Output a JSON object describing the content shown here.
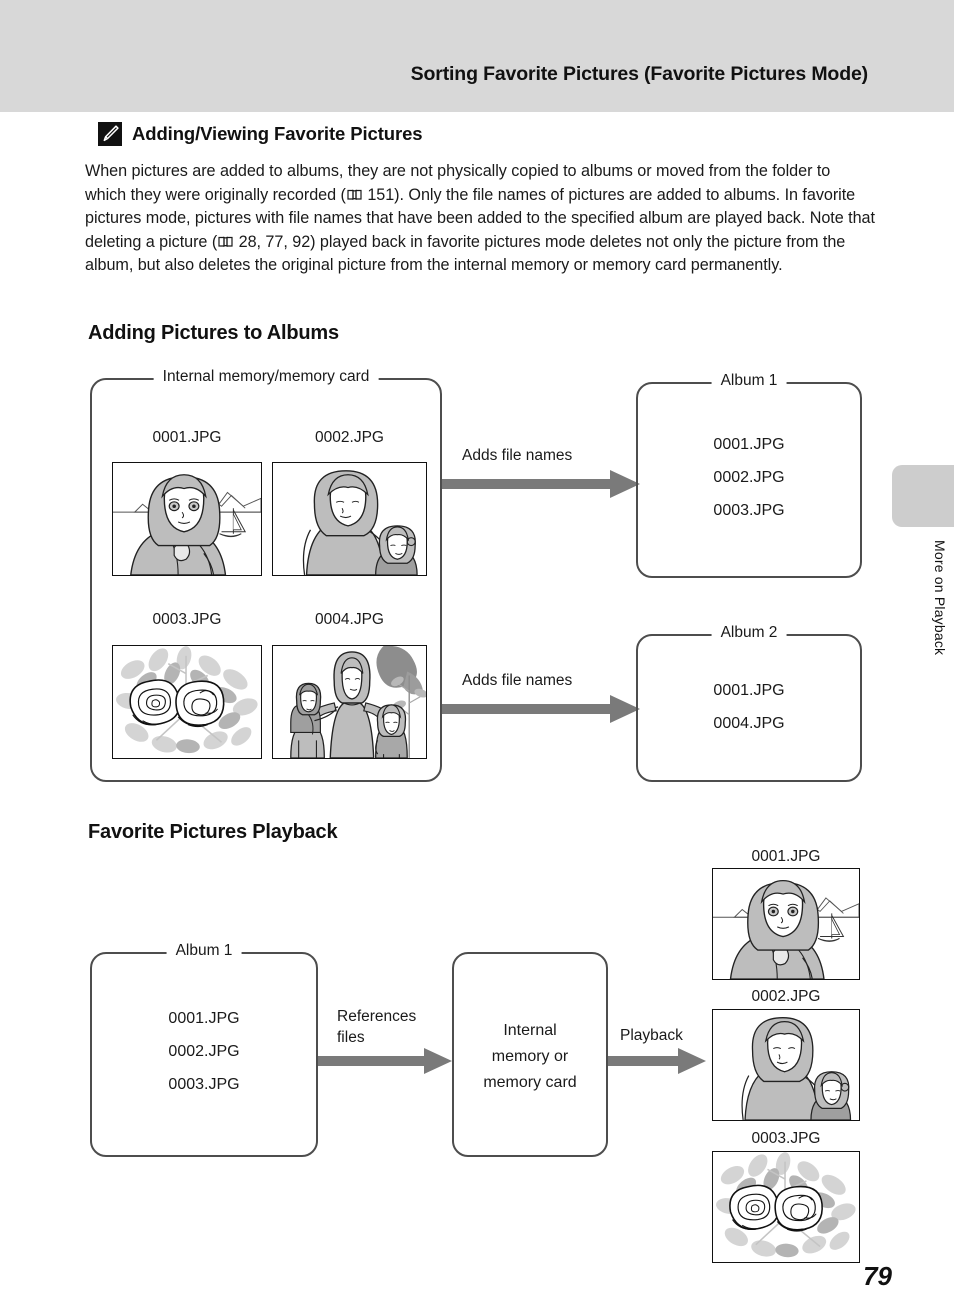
{
  "header": {
    "title": "Sorting Favorite Pictures (Favorite Pictures Mode)"
  },
  "side_tab": {
    "label": "More on Playback"
  },
  "note": {
    "icon": "pencil-icon",
    "title": "Adding/Viewing Favorite Pictures",
    "body_part1": "When pictures are added to albums, they are not physically copied to albums or moved from the folder to which they were originally recorded (",
    "ref1": " 151). Only the file names of pictures are added to albums. In favorite pictures mode, pictures with file names that have been added to the specified album are played back. Note that deleting a picture (",
    "ref2": " 28, 77, 92) played back in favorite pictures mode deletes not only the picture from the album, but also deletes the original picture from the internal memory or memory card permanently."
  },
  "sections": {
    "adding_heading": "Adding Pictures to Albums",
    "playback_heading": "Favorite Pictures Playback"
  },
  "adding_diagram": {
    "source_box_label": "Internal memory/memory card",
    "photos": [
      {
        "caption": "0001.JPG",
        "subject": "woman-at-beach-with-sailboat"
      },
      {
        "caption": "0002.JPG",
        "subject": "woman-holding-childs-hand"
      },
      {
        "caption": "0003.JPG",
        "subject": "roses-flowers"
      },
      {
        "caption": "0004.JPG",
        "subject": "mother-with-two-children"
      }
    ],
    "arrow1_label": "Adds file names",
    "arrow2_label": "Adds file names",
    "album1": {
      "label": "Album 1",
      "files": [
        "0001.JPG",
        "0002.JPG",
        "0003.JPG"
      ]
    },
    "album2": {
      "label": "Album 2",
      "files": [
        "0001.JPG",
        "0004.JPG"
      ]
    }
  },
  "playback_diagram": {
    "album": {
      "label": "Album 1",
      "files": [
        "0001.JPG",
        "0002.JPG",
        "0003.JPG"
      ]
    },
    "arrow1_label": "References\nfiles",
    "memory_box_text": "Internal\nmemory or\nmemory card",
    "arrow2_label": "Playback",
    "photos": [
      {
        "caption": "0001.JPG",
        "subject": "woman-at-beach-with-sailboat"
      },
      {
        "caption": "0002.JPG",
        "subject": "woman-holding-childs-hand"
      },
      {
        "caption": "0003.JPG",
        "subject": "roses-flowers"
      }
    ]
  },
  "footer": {
    "page_number": "79"
  },
  "colors": {
    "header_bg": "#d8d8d8",
    "tab_bg": "#cdcdcd",
    "arrow": "#7a7a7a",
    "box_border": "#4d4d4d",
    "text": "#1a1a1a"
  }
}
